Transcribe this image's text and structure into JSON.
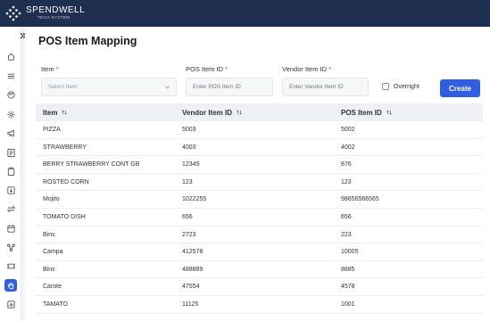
{
  "brand": {
    "name": "SPENDWELL",
    "subtitle": "TECH SYSTEM"
  },
  "sidebar": {
    "collapse_icon": "double-chevron-right-icon",
    "items": [
      {
        "icon": "home-icon"
      },
      {
        "icon": "menu-icon"
      },
      {
        "icon": "palette-icon"
      },
      {
        "icon": "settings-cog-icon"
      },
      {
        "icon": "megaphone-icon"
      },
      {
        "icon": "report-list-icon"
      },
      {
        "icon": "clipboard-icon"
      },
      {
        "icon": "download-icon"
      },
      {
        "icon": "transfer-arrows-icon"
      },
      {
        "icon": "calendar-icon"
      },
      {
        "icon": "nodes-icon"
      },
      {
        "icon": "ticket-icon"
      },
      {
        "icon": "hand-icon",
        "active": true
      },
      {
        "icon": "stats-icon"
      }
    ]
  },
  "page": {
    "title": "POS Item Mapping"
  },
  "form": {
    "item_label": "Item",
    "item_placeholder": "Select Item",
    "pos_label": "POS Item ID",
    "pos_placeholder": "Enter POS Item ID",
    "vendor_label": "Vendor Item ID",
    "vendor_placeholder": "Enter Vendor Item ID",
    "required_mark": "*",
    "overright_label": "Overright",
    "create_label": "Create"
  },
  "table": {
    "headers": [
      "Item",
      "Vendor Item ID",
      "POS Item ID"
    ],
    "rows": [
      [
        "PIZZA",
        "5003",
        "5002"
      ],
      [
        "STRAWBERRY",
        "4003",
        "4002"
      ],
      [
        "BERRY STRAWBERRY CONT GB",
        "12345",
        "876"
      ],
      [
        "ROSTED CORN",
        "123",
        "123"
      ],
      [
        "Mojito",
        "1022255",
        "98656566565"
      ],
      [
        "TOMATO DISH",
        "656",
        "656"
      ],
      [
        "Bins",
        "2723",
        "223"
      ],
      [
        "Campa",
        "412578",
        "10005"
      ],
      [
        "Bins",
        "488889",
        "8885"
      ],
      [
        "Carote",
        "47554",
        "4578"
      ],
      [
        "TAMATO",
        "11125",
        "1001"
      ]
    ]
  },
  "colors": {
    "topbar": "#1f2f4f",
    "accent": "#2f5fe0",
    "required": "#e23b3b"
  }
}
